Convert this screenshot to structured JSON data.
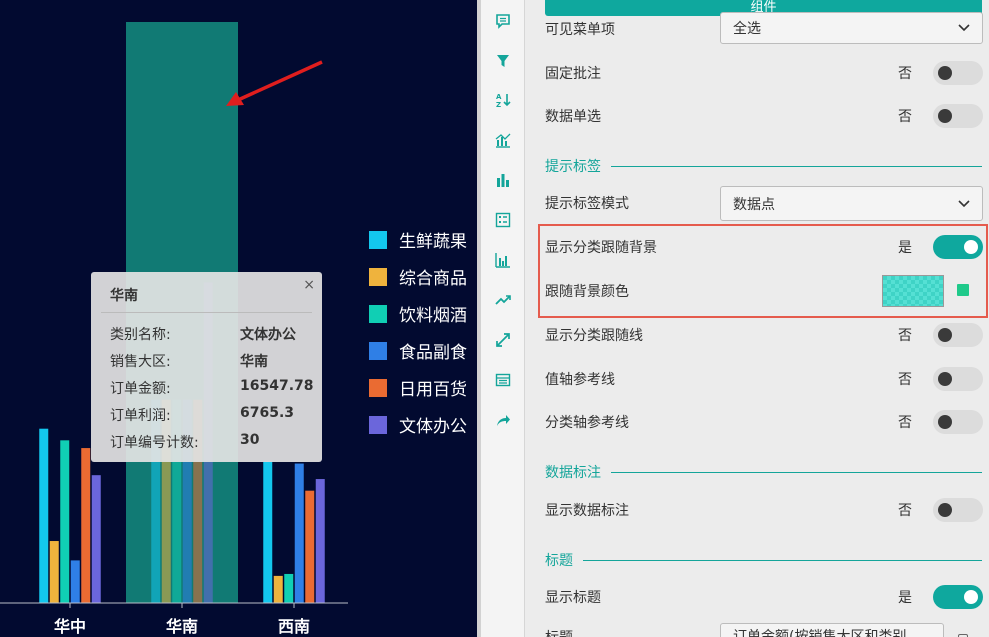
{
  "chart_data": {
    "type": "bar",
    "categories": [
      "华中",
      "华南",
      "西南"
    ],
    "series": [
      {
        "name": "生鲜蔬果",
        "values": [
          9,
          10.5,
          7.3
        ]
      },
      {
        "name": "综合商品",
        "values": [
          3.2,
          10.5,
          1.4
        ]
      },
      {
        "name": "饮料烟酒",
        "values": [
          8.4,
          10.5,
          1.5
        ]
      },
      {
        "name": "食品副食",
        "values": [
          2.2,
          10.5,
          7.2
        ]
      },
      {
        "name": "日用百货",
        "values": [
          8,
          10.5,
          5.8
        ]
      },
      {
        "name": "文体办公",
        "values": [
          6.6,
          16.55,
          6.4
        ]
      }
    ],
    "highlight_category": "华南",
    "ylim": [
      0,
      30
    ]
  },
  "colors": {
    "chart_bg": "#020a30",
    "highlight_band": "#117a74",
    "accent": "#0fa89e",
    "series": [
      "#13c7ee",
      "#efb33d",
      "#10cfb4",
      "#2f7fe6",
      "#ea6b32",
      "#6b66db"
    ],
    "arrow": "#e01e1e",
    "annotation_box": "#e55b4d"
  },
  "legend": [
    "生鲜蔬果",
    "综合商品",
    "饮料烟酒",
    "食品副食",
    "日用百货",
    "文体办公"
  ],
  "tooltip": {
    "title": "华南",
    "close": "×",
    "rows": [
      {
        "key": "类别名称:",
        "value": "文体办公"
      },
      {
        "key": "销售大区:",
        "value": "华南"
      },
      {
        "key": "订单金额:",
        "value": "16547.78"
      },
      {
        "key": "订单利润:",
        "value": "6765.3"
      },
      {
        "key": "订单编号计数:",
        "value": "30"
      }
    ]
  },
  "iconbar": [
    "comment-icon",
    "filter-icon",
    "sort-az-icon",
    "combo-chart-icon",
    "bar-chart-icon",
    "list-form-icon",
    "grouped-bar-icon",
    "trend-line-icon",
    "expand-icon",
    "table-icon",
    "share-icon"
  ],
  "panel": {
    "top_button": "组件",
    "rows": {
      "visible_menu": {
        "label": "可见菜单项",
        "value": "全选"
      },
      "fixed_annotation": {
        "label": "固定批注",
        "value": "否"
      },
      "data_single_select": {
        "label": "数据单选",
        "value": "否"
      },
      "tooltip_mode": {
        "label": "提示标签模式",
        "value": "数据点"
      },
      "show_cat_bg": {
        "label": "显示分类跟随背景",
        "value": "是"
      },
      "bg_color": {
        "label": "跟随背景颜色"
      },
      "show_cat_line": {
        "label": "显示分类跟随线",
        "value": "否"
      },
      "value_axis_ref": {
        "label": "值轴参考线",
        "value": "否"
      },
      "cat_axis_ref": {
        "label": "分类轴参考线",
        "value": "否"
      },
      "show_data_label": {
        "label": "显示数据标注",
        "value": "否"
      },
      "show_title": {
        "label": "显示标题",
        "value": "是"
      },
      "title": {
        "label": "标题",
        "value": "订单金额(按销售大区和类别"
      }
    },
    "sections": {
      "tooltip": "提示标签",
      "data_label": "数据标注",
      "title": "标题"
    }
  }
}
